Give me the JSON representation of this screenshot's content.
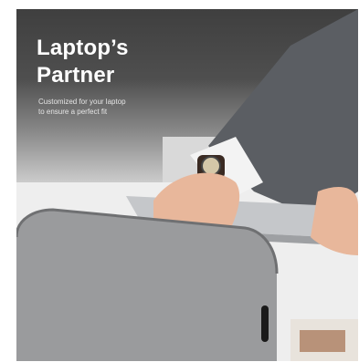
{
  "headline": {
    "line1": "Laptop’s",
    "line2": "Partner"
  },
  "subline": {
    "line1": "Customized for your laptop",
    "line2": "to ensure a perfect fit"
  },
  "colors": {
    "sleeve_gray": "#9a9b9d",
    "laptop_silver": "#c5c7ca",
    "shirt_white": "#f3f3f3",
    "jacket_gray": "#5b5e63",
    "skin": "#e8b79b"
  },
  "icons": [
    "zipper-pull-icon",
    "watch-icon"
  ]
}
